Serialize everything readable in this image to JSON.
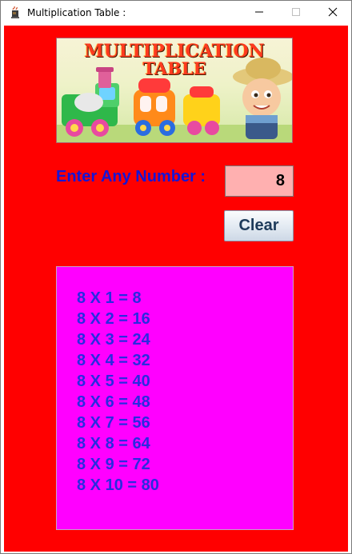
{
  "window": {
    "title": "Multiplication Table :",
    "app_icon": "java-cup-icon",
    "controls": {
      "minimize_icon": "minimize-icon",
      "maximize_icon": "maximize-icon",
      "close_icon": "close-icon"
    }
  },
  "banner": {
    "line1": "MULTIPLICATION",
    "line2": "TABLE"
  },
  "form": {
    "prompt": "Enter Any Number :",
    "number_value": "8",
    "clear_label": "Clear"
  },
  "table": {
    "rows": [
      "8 X 1 = 8",
      "8 X 2 = 16",
      "8 X 3 = 24",
      "8 X 4 = 32",
      "8 X 5 = 40",
      "8 X 6 = 48",
      "8 X 7 = 56",
      "8 X 8 = 64",
      "8 X 9 = 72",
      "8 X 10 = 80"
    ]
  },
  "colors": {
    "background": "#ff0000",
    "input_bg": "#ffb0b0",
    "panel_bg": "#ff00ff",
    "label_blue": "#1515d6",
    "row_blue": "#2a2ae0"
  }
}
